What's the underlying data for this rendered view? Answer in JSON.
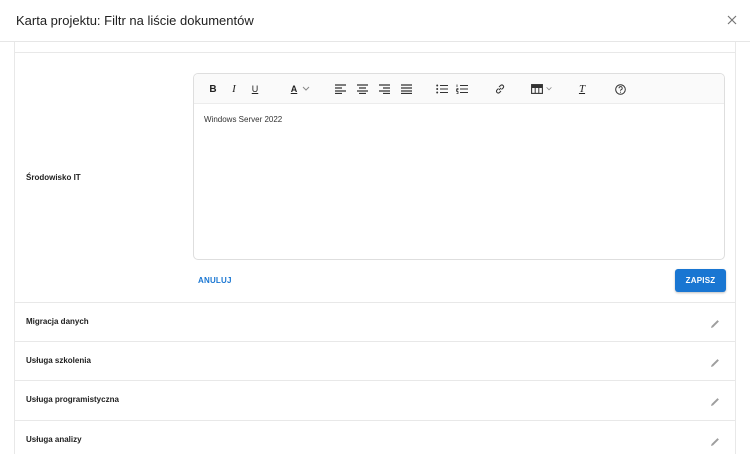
{
  "dialog": {
    "title": "Karta projektu: Filtr na liście dokumentów"
  },
  "field": {
    "label": "Środowisko IT"
  },
  "editor": {
    "content": "Windows Server 2022",
    "toolbar": {
      "bold": "B",
      "italic": "I",
      "underline": "U",
      "font_color": "A",
      "clear_format": "T",
      "icons": [
        "bold-icon",
        "italic-icon",
        "underline-icon",
        "font-color-icon",
        "align-left-icon",
        "align-center-icon",
        "align-right-icon",
        "align-justify-icon",
        "bullet-list-icon",
        "numbered-list-icon",
        "link-icon",
        "table-icon",
        "clear-format-icon",
        "help-icon"
      ]
    }
  },
  "actions": {
    "cancel": "ANULUJ",
    "save": "ZAPISZ"
  },
  "rows": [
    {
      "label": "Migracja danych"
    },
    {
      "label": "Usługa szkolenia"
    },
    {
      "label": "Usługa programistyczna"
    },
    {
      "label": "Usługa analizy"
    }
  ],
  "colors": {
    "accent": "#1976d2",
    "border": "#e8e8e8",
    "icon": "#9e9e9e"
  }
}
